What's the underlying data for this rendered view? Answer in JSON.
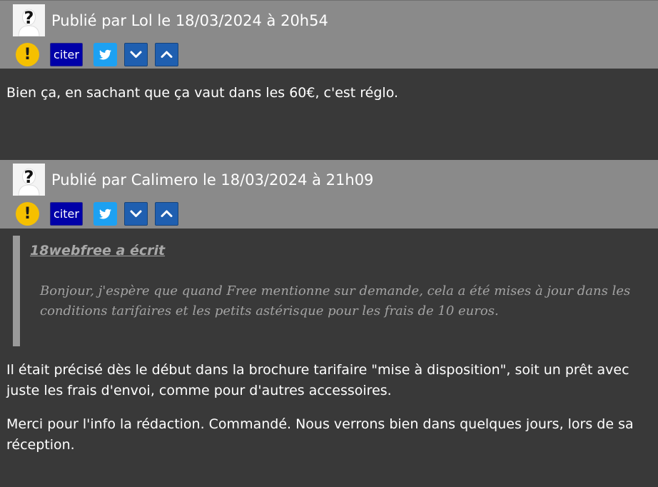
{
  "posts": [
    {
      "byline": "Publié par Lol le 18/03/2024 à 20h54",
      "actions": {
        "warn_label": "!",
        "cite_label": "citer",
        "icons": [
          "warning-icon",
          "twitter-icon",
          "chevron-down-icon",
          "chevron-up-icon"
        ]
      },
      "body": "Bien ça, en sachant que ça vaut dans les 60€, c'est réglo."
    },
    {
      "byline": "Publié par Calimero le 18/03/2024 à 21h09",
      "actions": {
        "warn_label": "!",
        "cite_label": "citer",
        "icons": [
          "warning-icon",
          "twitter-icon",
          "chevron-down-icon",
          "chevron-up-icon"
        ]
      },
      "quote": {
        "author": "18webfree a écrit",
        "text": "Bonjour, j'espère que quand Free mentionne sur demande, cela a été mises à jour dans les conditions tarifaires et les petits astérisque pour les frais de 10 euros."
      },
      "paragraphs": [
        "Il était précisé dès le début dans la brochure tarifaire \"mise à disposition\", soit un prêt avec juste les frais d'envoi, comme pour d'autres accessoires.",
        "Merci pour l'info la rédaction. Commandé. Nous verrons bien dans quelques jours, lors de sa réception."
      ]
    }
  ],
  "colors": {
    "page_bg": "#393939",
    "header_bg": "#8a8a8a",
    "warning": "#f5c000",
    "cite_bg": "#0000a8",
    "twitter": "#1da1f2",
    "vote_bg": "#1f5fb0",
    "quote_bar": "#9a9a9a"
  }
}
